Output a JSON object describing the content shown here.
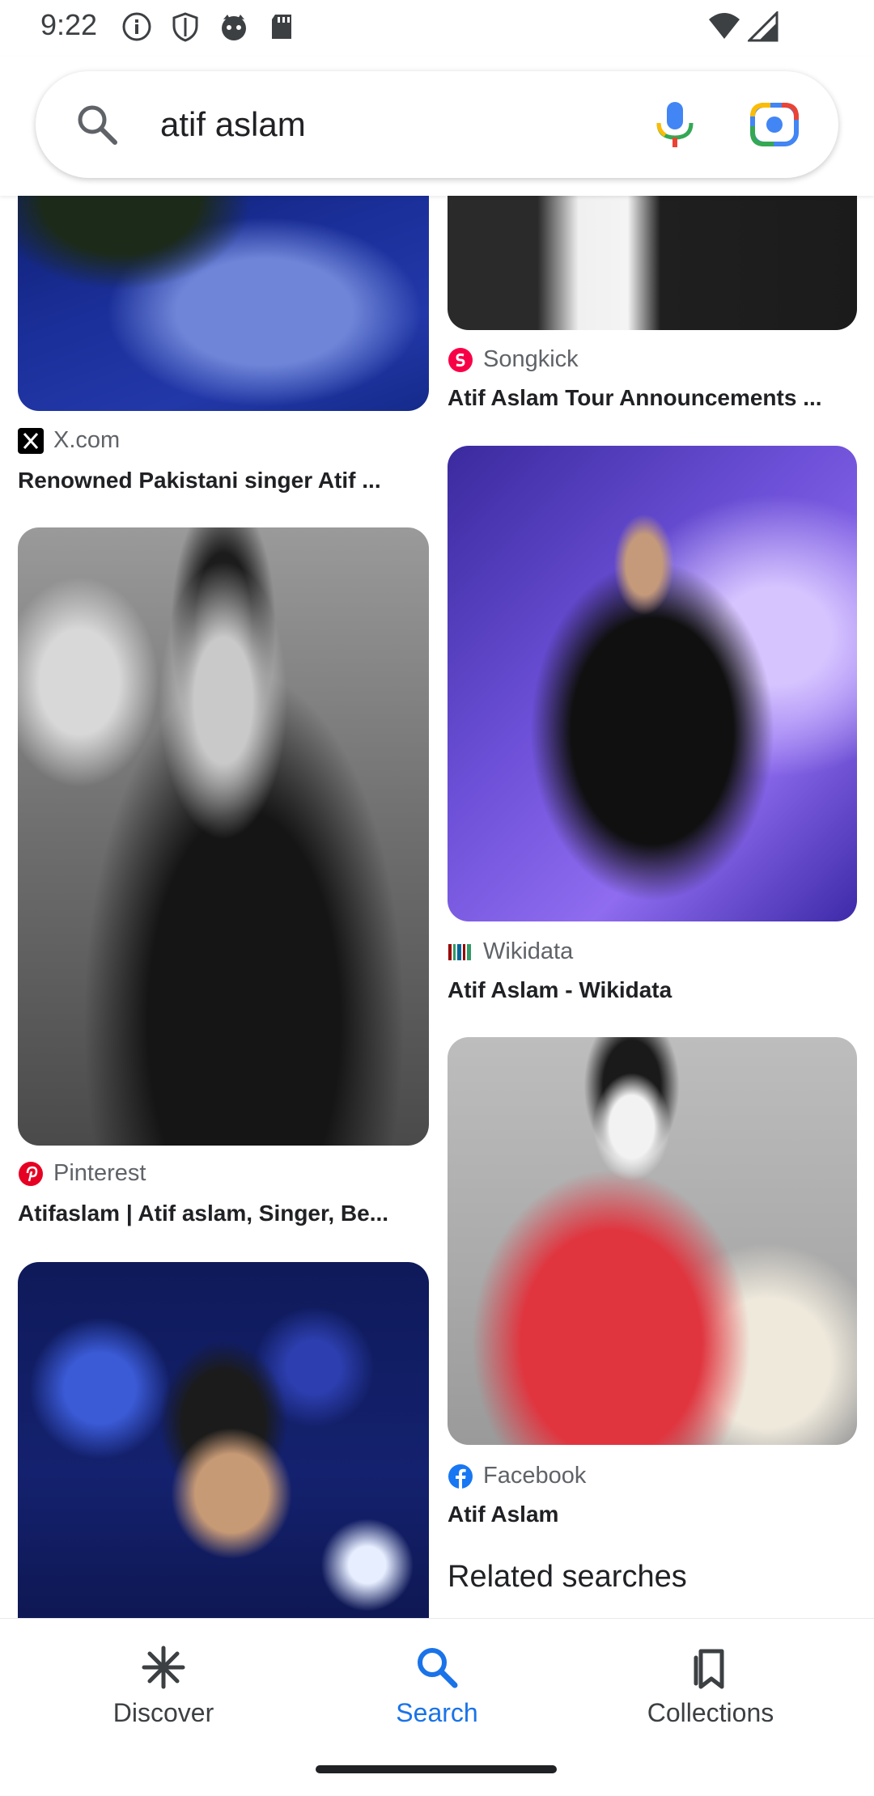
{
  "status_bar": {
    "time": "9:22",
    "left_icons": [
      "info-icon",
      "shield-icon",
      "cat-face-icon",
      "sd-card-icon"
    ],
    "right_icons": [
      "wifi-icon",
      "signal-icon"
    ]
  },
  "search": {
    "query": "atif aslam",
    "icons": [
      "search-icon",
      "mic-icon",
      "lens-icon"
    ]
  },
  "results": [
    {
      "source": "X.com",
      "title": "Renowned Pakistani singer Atif ...",
      "icon": "x-logo-icon",
      "image": "Performer in blue jacket on stage"
    },
    {
      "source": "Songkick",
      "title": "Atif Aslam Tour Announcements ...",
      "icon": "songkick-logo-icon",
      "image": "Man in black suit and white shirt"
    },
    {
      "source": "Wikidata",
      "title": "Atif Aslam - Wikidata",
      "icon": "wikidata-logo-icon",
      "image": "Singer in black jacket on stage with purple lights"
    },
    {
      "source": "Pinterest",
      "title": "Atifaslam | Atif aslam, Singer, Be...",
      "icon": "pinterest-logo-icon",
      "image": "Black and white portrait waving"
    },
    {
      "source": "Facebook",
      "title": "Atif Aslam",
      "icon": "facebook-logo-icon",
      "image": "Man in white sunglasses and red varsity jacket"
    },
    {
      "source": "",
      "title": "",
      "icon": "",
      "image": "Singer on stage with blue bokeh lights"
    }
  ],
  "related_searches_label": "Related searches",
  "bottom_nav": [
    {
      "label": "Discover",
      "icon": "discover-asterisk-icon",
      "active": false
    },
    {
      "label": "Search",
      "icon": "search-icon",
      "active": true
    },
    {
      "label": "Collections",
      "icon": "collections-icon",
      "active": false
    }
  ],
  "colors": {
    "accent": "#1a73e8",
    "text": "#202124",
    "secondary_text": "#5f6368"
  }
}
